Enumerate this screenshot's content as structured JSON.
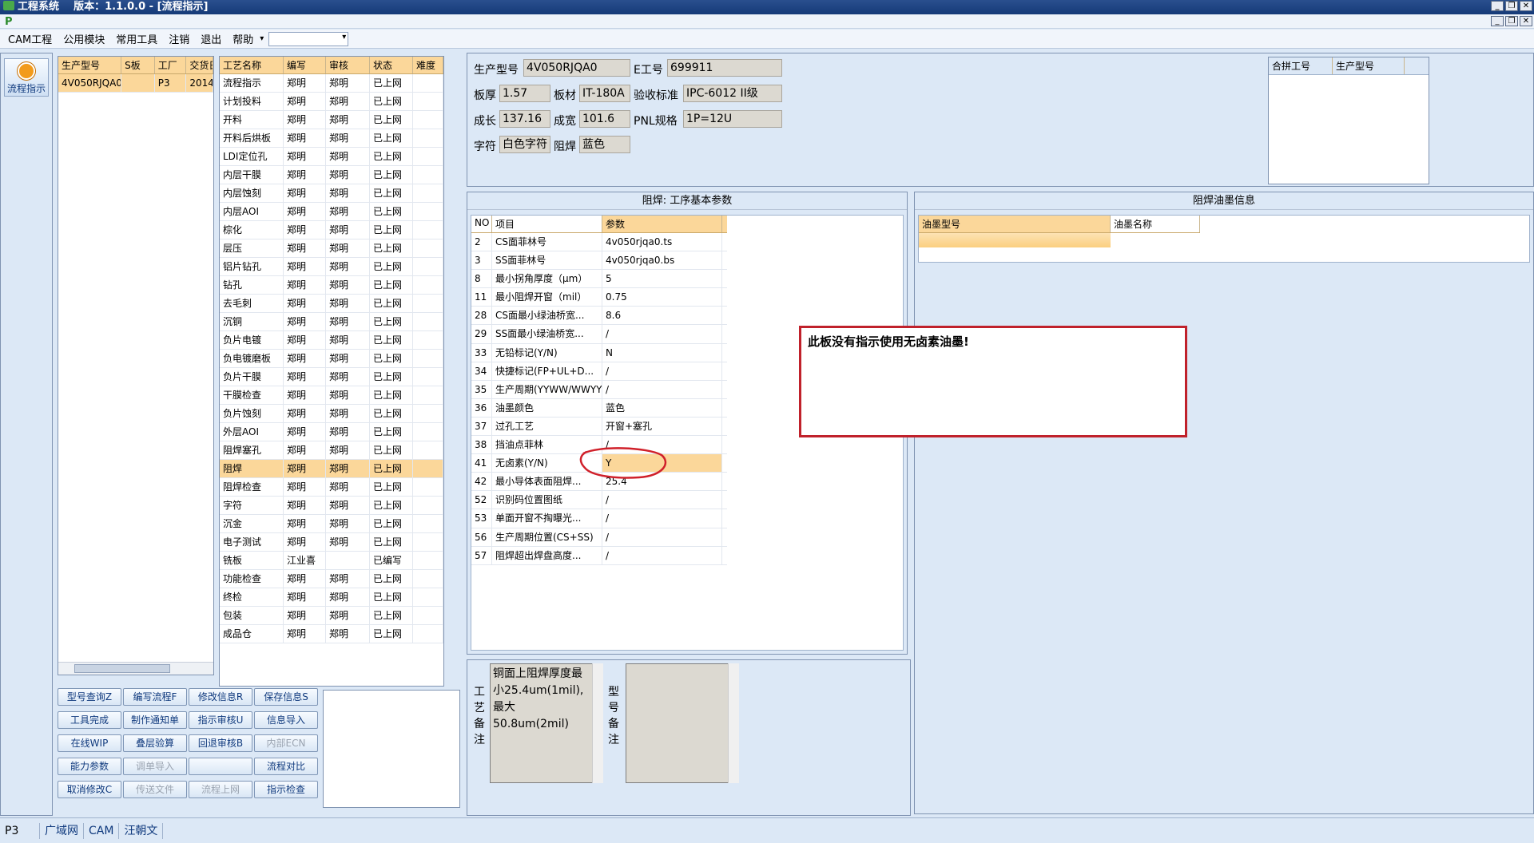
{
  "titlebar": {
    "app": "工程系统",
    "version": "版本：1.1.0.0 - [流程指示]"
  },
  "menu": [
    "CAM工程",
    "公用模块",
    "常用工具",
    "注销",
    "退出",
    "帮助"
  ],
  "sidebar": {
    "flow_button": "流程指示"
  },
  "left_grid": {
    "headers": [
      "生产型号",
      "S板",
      "工厂",
      "交货日"
    ],
    "rows": [
      [
        "4V050RJQA0",
        "",
        "P3",
        "2014/"
      ]
    ]
  },
  "process_grid": {
    "headers": [
      "工艺名称",
      "编写",
      "审核",
      "状态",
      "难度"
    ],
    "rows": [
      [
        "流程指示",
        "郑明",
        "郑明",
        "已上网",
        ""
      ],
      [
        "计划投料",
        "郑明",
        "郑明",
        "已上网",
        ""
      ],
      [
        "开料",
        "郑明",
        "郑明",
        "已上网",
        ""
      ],
      [
        "开料后烘板",
        "郑明",
        "郑明",
        "已上网",
        ""
      ],
      [
        "LDI定位孔",
        "郑明",
        "郑明",
        "已上网",
        ""
      ],
      [
        "内层干膜",
        "郑明",
        "郑明",
        "已上网",
        ""
      ],
      [
        "内层蚀刻",
        "郑明",
        "郑明",
        "已上网",
        ""
      ],
      [
        "内层AOI",
        "郑明",
        "郑明",
        "已上网",
        ""
      ],
      [
        "棕化",
        "郑明",
        "郑明",
        "已上网",
        ""
      ],
      [
        "层压",
        "郑明",
        "郑明",
        "已上网",
        ""
      ],
      [
        "铝片钻孔",
        "郑明",
        "郑明",
        "已上网",
        ""
      ],
      [
        "钻孔",
        "郑明",
        "郑明",
        "已上网",
        ""
      ],
      [
        "去毛刺",
        "郑明",
        "郑明",
        "已上网",
        ""
      ],
      [
        "沉铜",
        "郑明",
        "郑明",
        "已上网",
        ""
      ],
      [
        "负片电镀",
        "郑明",
        "郑明",
        "已上网",
        ""
      ],
      [
        "负电镀磨板",
        "郑明",
        "郑明",
        "已上网",
        ""
      ],
      [
        "负片干膜",
        "郑明",
        "郑明",
        "已上网",
        ""
      ],
      [
        "干膜检查",
        "郑明",
        "郑明",
        "已上网",
        ""
      ],
      [
        "负片蚀刻",
        "郑明",
        "郑明",
        "已上网",
        ""
      ],
      [
        "外层AOI",
        "郑明",
        "郑明",
        "已上网",
        ""
      ],
      [
        "阻焊塞孔",
        "郑明",
        "郑明",
        "已上网",
        ""
      ],
      [
        "阻焊",
        "郑明",
        "郑明",
        "已上网",
        ""
      ],
      [
        "阻焊检查",
        "郑明",
        "郑明",
        "已上网",
        ""
      ],
      [
        "字符",
        "郑明",
        "郑明",
        "已上网",
        ""
      ],
      [
        "沉金",
        "郑明",
        "郑明",
        "已上网",
        ""
      ],
      [
        "电子测试",
        "郑明",
        "郑明",
        "已上网",
        ""
      ],
      [
        "铣板",
        "江业喜",
        "",
        "已编写",
        ""
      ],
      [
        "功能检查",
        "郑明",
        "郑明",
        "已上网",
        ""
      ],
      [
        "终检",
        "郑明",
        "郑明",
        "已上网",
        ""
      ],
      [
        "包装",
        "郑明",
        "郑明",
        "已上网",
        ""
      ],
      [
        "成品仓",
        "郑明",
        "郑明",
        "已上网",
        ""
      ]
    ],
    "selected_index": 21
  },
  "buttons": [
    [
      "型号查询Z",
      "编写流程F",
      "修改信息R",
      "保存信息S"
    ],
    [
      "工具完成",
      "制作通知单",
      "指示审核U",
      "信息导入"
    ],
    [
      "在线WIP",
      "叠层验算",
      "回退审核B",
      "内部ECN"
    ],
    [
      "能力参数",
      "调单导入",
      "",
      "流程对比"
    ],
    [
      "取消修改C",
      "传送文件",
      "流程上网",
      "指示检查"
    ]
  ],
  "disabled_buttons": [
    "内部ECN",
    "调单导入",
    "传送文件",
    "流程上网"
  ],
  "info": {
    "labels": {
      "model": "生产型号",
      "e_no": "E工号",
      "thickness": "板厚",
      "material": "板材",
      "standard": "验收标准",
      "length": "成长",
      "width": "成宽",
      "pnl": "PNL规格",
      "text": "字符",
      "mask": "阻焊"
    },
    "values": {
      "model": "4V050RJQA0",
      "e_no": "699911",
      "thickness": "1.57",
      "material": "IT-180A",
      "standard": "IPC-6012 II级",
      "length": "137.16",
      "width": "101.6",
      "pnl": "1P=12U",
      "text": "白色字符",
      "mask": "蓝色"
    }
  },
  "merge_grid": {
    "headers": [
      "合拼工号",
      "生产型号"
    ]
  },
  "params": {
    "title": "阻焊: 工序基本参数",
    "headers": [
      "NO",
      "项目",
      "参数"
    ],
    "rows": [
      [
        "2",
        "CS面菲林号",
        "4v050rjqa0.ts"
      ],
      [
        "3",
        "SS面菲林号",
        "4v050rjqa0.bs"
      ],
      [
        "8",
        "最小拐角厚度（μm）",
        "5"
      ],
      [
        "11",
        "最小阻焊开窗（mil）",
        "0.75"
      ],
      [
        "28",
        "CS面最小绿油桥宽...",
        "8.6"
      ],
      [
        "29",
        "SS面最小绿油桥宽...",
        "/"
      ],
      [
        "33",
        "无铅标记(Y/N)",
        "N"
      ],
      [
        "34",
        "快捷标记(FP+UL+D...",
        "/"
      ],
      [
        "35",
        "生产周期(YYWW/WWYY)",
        "/"
      ],
      [
        "36",
        "油墨颜色",
        "蓝色"
      ],
      [
        "37",
        "过孔工艺",
        "开窗+塞孔"
      ],
      [
        "38",
        "挡油点菲林",
        "/"
      ],
      [
        "41",
        "无卤素(Y/N)",
        "Y"
      ],
      [
        "42",
        "最小导体表面阻焊...",
        "25.4"
      ],
      [
        "52",
        "识别码位置图纸",
        "/"
      ],
      [
        "53",
        "单面开窗不掏曝光...",
        "/"
      ],
      [
        "56",
        "生产周期位置(CS+SS)",
        "/"
      ],
      [
        "57",
        "阻焊超出焊盘高度...",
        "/"
      ]
    ],
    "selected_index": 12
  },
  "ink": {
    "title": "阻焊油墨信息",
    "headers": [
      "油墨型号",
      "油墨名称"
    ]
  },
  "alert": {
    "text": "此板没有指示使用无卤素油墨!"
  },
  "notes": {
    "process_label": "工艺备注",
    "process_text": "铜面上阻焊厚度最小25.4um(1mil),最大50.8um(2mil)",
    "model_label": "型号备注",
    "model_text": ""
  },
  "statusbar": {
    "factory": "P3",
    "network": "广域网",
    "dept": "CAM",
    "user": "汪朝文"
  },
  "colors": {
    "accent": "#fbd79a",
    "alert_border": "#c0212b",
    "annotation": "#d0202a"
  }
}
